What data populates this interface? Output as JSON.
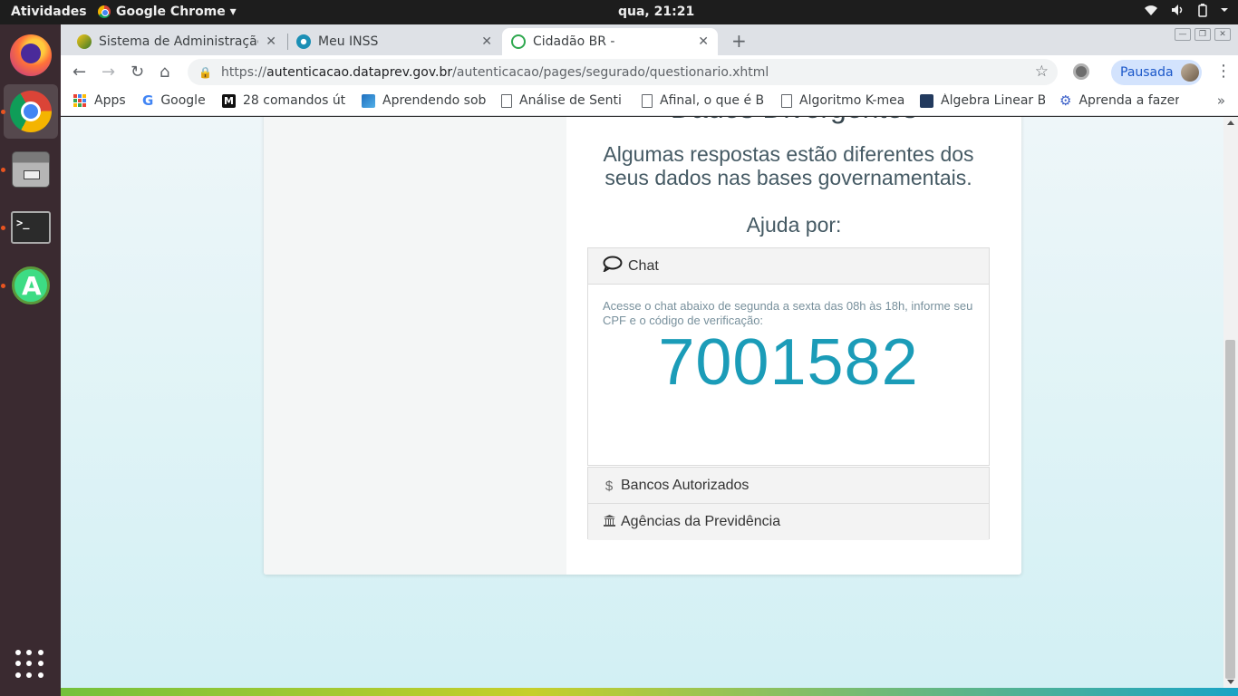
{
  "topbar": {
    "activities": "Atividades",
    "app_name": "Google Chrome ▾",
    "clock": "qua, 21:21",
    "tray_icons": [
      "wifi-icon",
      "volume-icon",
      "battery-icon",
      "chevron-down-icon"
    ]
  },
  "dock": {
    "items": [
      "firefox",
      "google-chrome",
      "files",
      "terminal",
      "android-studio",
      "show-applications"
    ]
  },
  "tabs": [
    {
      "title": "Sistema de Administração",
      "favicon_color": "#3a7a2a"
    },
    {
      "title": "Meu INSS",
      "favicon_color": "#1b8fb5"
    },
    {
      "title": "Cidadão BR -",
      "favicon_color": "#2fa84f"
    }
  ],
  "toolbar": {
    "url_scheme": "https://",
    "url_host": "autenticacao.dataprev.gov.br",
    "url_path": "/autenticacao/pages/segurado/questionario.xhtml",
    "profile_label": "Pausada"
  },
  "bookmarks": [
    {
      "label": "Apps"
    },
    {
      "label": "Google"
    },
    {
      "label": "28 comandos út"
    },
    {
      "label": "Aprendendo sob"
    },
    {
      "label": "Análise de Senti"
    },
    {
      "label": "Afinal, o que é B"
    },
    {
      "label": "Algoritmo K-mea"
    },
    {
      "label": "Álgebra Linear B"
    },
    {
      "label": "Aprenda a fazer"
    }
  ],
  "page": {
    "heading": "Dados Divergentes",
    "subtitle": "Algumas respostas estão diferentes dos seus dados nas bases governamentais.",
    "help_label": "Ajuda por:",
    "chat": {
      "title": "Chat",
      "description": "Acesse o chat abaixo de segunda a sexta das 08h às 18h, informe seu CPF e o código de verificação:",
      "code": "7001582"
    },
    "banks": {
      "title": "Bancos Autorizados"
    },
    "agencies": {
      "title": "Agências da Previdência"
    }
  }
}
